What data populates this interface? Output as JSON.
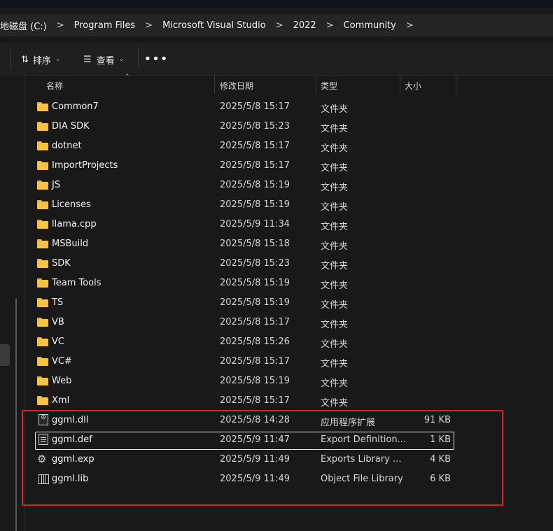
{
  "breadcrumb": [
    "地磁盘 (C:)",
    "Program Files",
    "Microsoft Visual Studio",
    "2022",
    "Community"
  ],
  "toolbar": {
    "sort_label": "排序",
    "view_label": "查看",
    "more_label": "•••"
  },
  "columns": {
    "name": "名称",
    "date": "修改日期",
    "type": "类型",
    "size": "大小"
  },
  "folders": [
    {
      "name": "Common7",
      "date": "2025/5/8 15:17",
      "type": "文件夹"
    },
    {
      "name": "DIA SDK",
      "date": "2025/5/8 15:23",
      "type": "文件夹"
    },
    {
      "name": "dotnet",
      "date": "2025/5/8 15:17",
      "type": "文件夹"
    },
    {
      "name": "ImportProjects",
      "date": "2025/5/8 15:17",
      "type": "文件夹"
    },
    {
      "name": "JS",
      "date": "2025/5/8 15:19",
      "type": "文件夹"
    },
    {
      "name": "Licenses",
      "date": "2025/5/8 15:19",
      "type": "文件夹"
    },
    {
      "name": "llama.cpp",
      "date": "2025/5/9 11:34",
      "type": "文件夹"
    },
    {
      "name": "MSBuild",
      "date": "2025/5/8 15:18",
      "type": "文件夹"
    },
    {
      "name": "SDK",
      "date": "2025/5/8 15:23",
      "type": "文件夹"
    },
    {
      "name": "Team Tools",
      "date": "2025/5/8 15:19",
      "type": "文件夹"
    },
    {
      "name": "TS",
      "date": "2025/5/8 15:19",
      "type": "文件夹"
    },
    {
      "name": "VB",
      "date": "2025/5/8 15:17",
      "type": "文件夹"
    },
    {
      "name": "VC",
      "date": "2025/5/8 15:26",
      "type": "文件夹"
    },
    {
      "name": "VC#",
      "date": "2025/5/8 15:17",
      "type": "文件夹"
    },
    {
      "name": "Web",
      "date": "2025/5/8 15:19",
      "type": "文件夹"
    },
    {
      "name": "Xml",
      "date": "2025/5/8 15:17",
      "type": "文件夹"
    }
  ],
  "files": [
    {
      "name": "ggml.dll",
      "date": "2025/5/8 14:28",
      "type": "应用程序扩展",
      "size": "91 KB",
      "icon": "dll-file-icon"
    },
    {
      "name": "ggml.def",
      "date": "2025/5/9 11:47",
      "type": "Export Definition...",
      "size": "1 KB",
      "icon": "text-file-icon"
    },
    {
      "name": "ggml.exp",
      "date": "2025/5/9 11:49",
      "type": "Exports Library ...",
      "size": "4 KB",
      "icon": "gear-file-icon"
    },
    {
      "name": "ggml.lib",
      "date": "2025/5/9 11:49",
      "type": "Object File Library",
      "size": "6 KB",
      "icon": "library-file-icon"
    }
  ],
  "colors": {
    "background": "#191919",
    "folder": "#f6c343",
    "highlight_box": "#e02020"
  }
}
